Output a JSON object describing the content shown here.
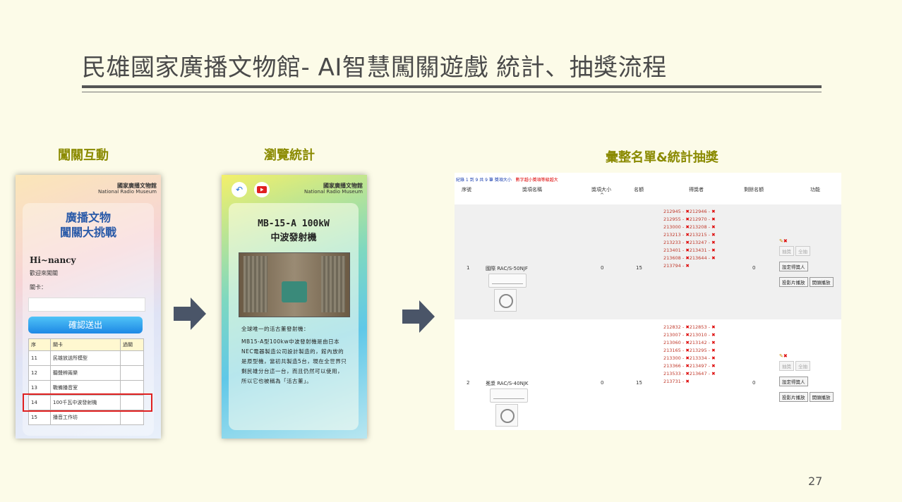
{
  "title": "民雄國家廣播文物館- AI智慧闖關遊戲 統計、抽獎流程",
  "page_number": "27",
  "sections": {
    "interaction": "闖關互動",
    "browse": "瀏覽統計",
    "summary": "彙整名單&統計抽獎"
  },
  "phone1": {
    "logo_zh": "國家廣播文物館",
    "logo_en": "National Radio Museum",
    "game_title_1": "廣播文物",
    "game_title_2": "闖關大挑戰",
    "greeting": "Hi~nancy",
    "welcome": "歡迎來闖關",
    "stage_label": "關卡：",
    "submit": "確認送出",
    "table_headers": [
      "序",
      "關卡",
      "過關"
    ],
    "rows": [
      {
        "no": "11",
        "name": "民雄放送所模型",
        "pass": ""
      },
      {
        "no": "12",
        "name": "聽聲辨兩樂",
        "pass": ""
      },
      {
        "no": "13",
        "name": "戰備播音室",
        "pass": ""
      },
      {
        "no": "14",
        "name": "100千瓦中波發射機",
        "pass": ""
      },
      {
        "no": "15",
        "name": "播音工作坊",
        "pass": ""
      }
    ]
  },
  "phone2": {
    "logo_zh": "國家廣播文物館",
    "logo_en": "National Radio Museum",
    "exhibit_title_1": "MB-15-A 100kW",
    "exhibit_title_2": "中波發射機",
    "intro_heading": "全球唯一的活古董發射機：",
    "intro_body": "MB15-A型100kw中波發射機是由日本NEC電器製造公司設計製造的，館內放的是原型機，當初共製造5台，現在全世界只剩民雄分台這一台，而且仍然可以使用，所以它也被稱為「活古董」。"
  },
  "panel": {
    "paging": "紀錄 1 到 9 共 9 筆",
    "paging_sort": "獎項大小",
    "paging_note": "數字越小獎項等級越大",
    "headers": {
      "no": "序號",
      "prize": "獎項名稱",
      "level": "獎項大小",
      "level_sort": "^",
      "quota": "名額",
      "winners": "得獎者",
      "remaining": "剩餘名額",
      "actions": "功能"
    },
    "buttons": {
      "draw": "抽獎",
      "all": "全抽",
      "set_winner": "設定得獎人",
      "slideshow": "投影片播放",
      "start_play": "開頭播放"
    },
    "rows": [
      {
        "no": "1",
        "prize": "國際 RAC/S-50NJF",
        "level": "0",
        "quota": "15",
        "remaining": "0",
        "winners": [
          [
            "212945",
            "212946"
          ],
          [
            "212955",
            "212970"
          ],
          [
            "213000",
            "213208"
          ],
          [
            "213213",
            "213215"
          ],
          [
            "213233",
            "213247"
          ],
          [
            "213401",
            "213431"
          ],
          [
            "213608",
            "213644"
          ],
          [
            "213794",
            ""
          ]
        ]
      },
      {
        "no": "2",
        "prize": "冕漿 RAC/S-40NJK",
        "level": "0",
        "quota": "15",
        "remaining": "0",
        "winners": [
          [
            "212832",
            "212853"
          ],
          [
            "213007",
            "213010"
          ],
          [
            "213060",
            "213142"
          ],
          [
            "213165",
            "213295"
          ],
          [
            "213300",
            "213334"
          ],
          [
            "213366",
            "213497"
          ],
          [
            "213533",
            "213647"
          ],
          [
            "213731",
            ""
          ]
        ]
      }
    ]
  },
  "colors": {
    "background": "#fcfbe8",
    "section_title": "#8a8a00",
    "highlight_box": "#e02020",
    "arrow": "#4a5568"
  }
}
